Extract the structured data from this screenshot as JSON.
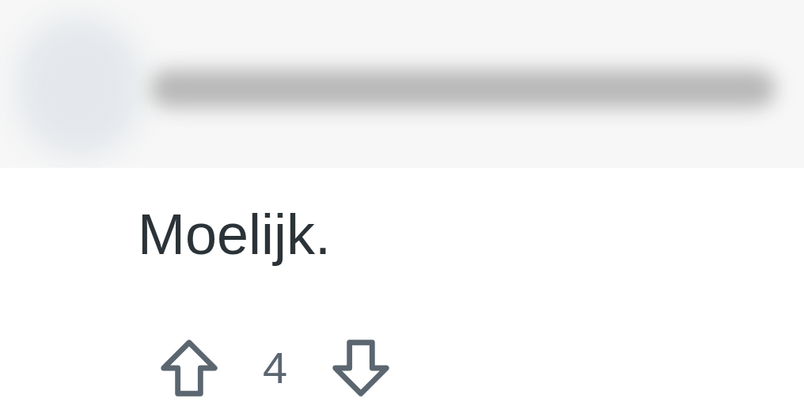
{
  "comment": {
    "text": "Moelijk.",
    "score": "4"
  }
}
